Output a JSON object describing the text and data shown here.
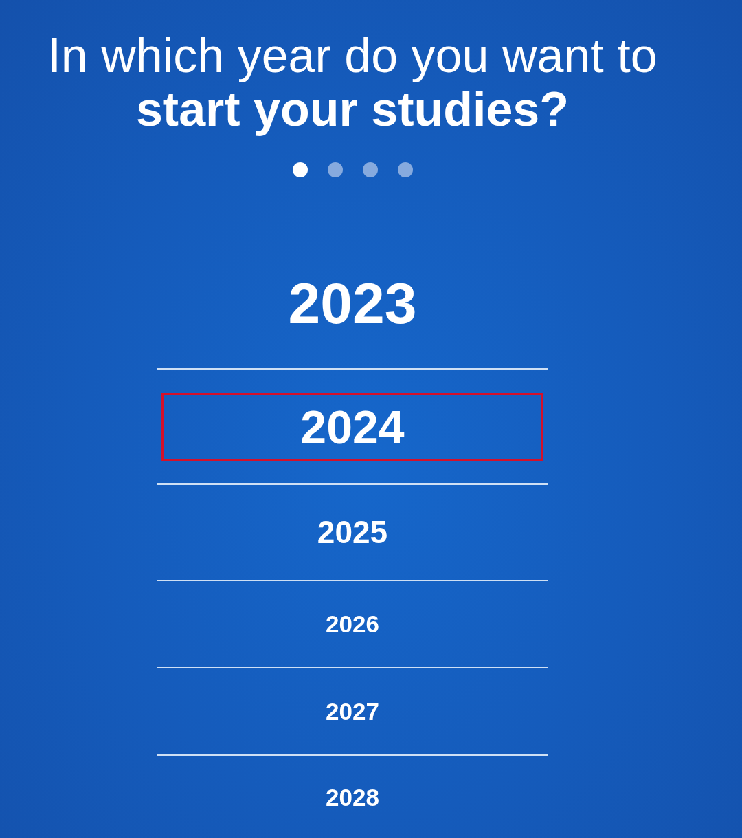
{
  "title": "In which year do you want to **start your studies?**",
  "page_dots": [
    {
      "selected": true
    },
    {
      "selected": false
    },
    {
      "selected": false
    },
    {
      "selected": false
    }
  ],
  "years": [
    {
      "label": "2023",
      "selected": false
    },
    {
      "label": "2024",
      "selected": true
    },
    {
      "label": "2025",
      "selected": false
    },
    {
      "label": "2026",
      "selected": false
    },
    {
      "label": "2027",
      "selected": false
    },
    {
      "label": "2028",
      "selected": false
    }
  ]
}
